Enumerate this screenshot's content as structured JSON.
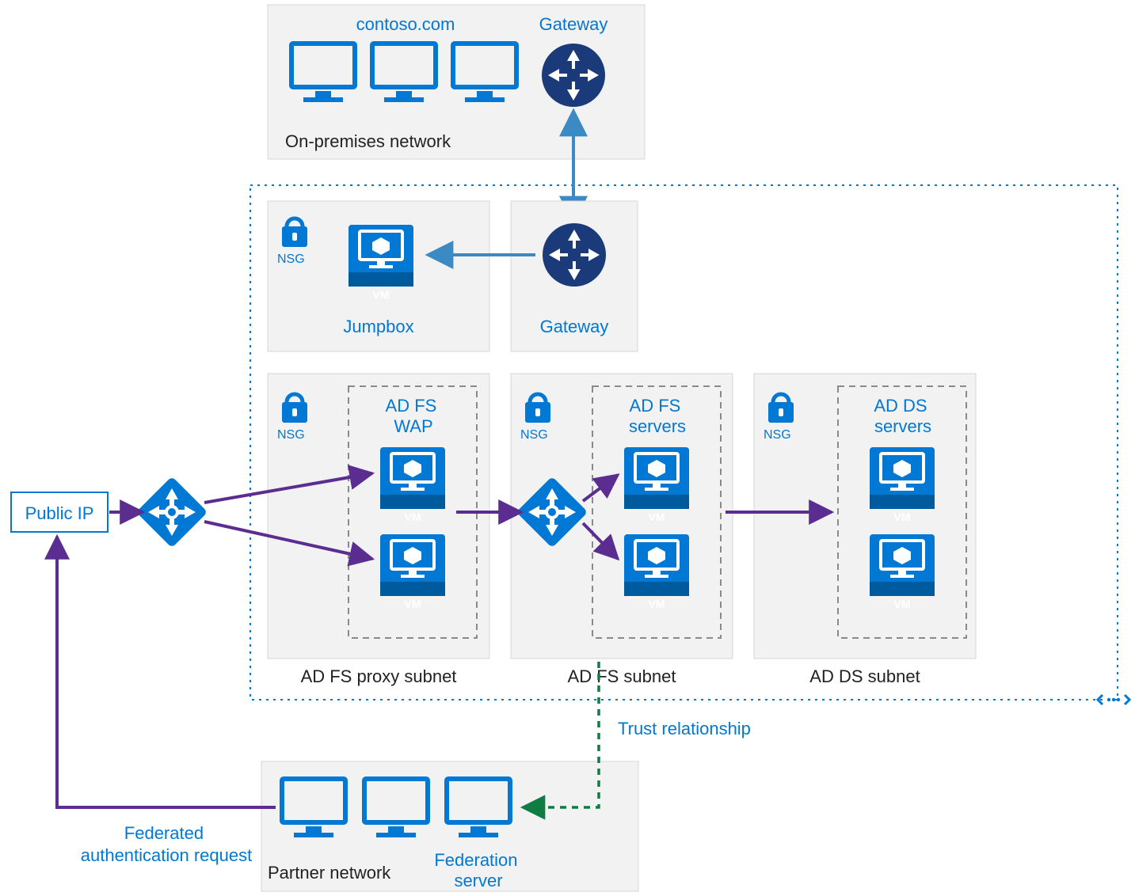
{
  "onprem": {
    "domain": "contoso.com",
    "gateway": "Gateway",
    "label": "On-premises network"
  },
  "vnet": {
    "jumpbox": {
      "nsg": "NSG",
      "label": "Jumpbox"
    },
    "gateway": {
      "label": "Gateway"
    },
    "adfs_proxy": {
      "nsg": "NSG",
      "title": "AD FS WAP",
      "label": "AD FS proxy subnet"
    },
    "adfs": {
      "nsg": "NSG",
      "title": "AD FS servers",
      "label": "AD FS subnet"
    },
    "adds": {
      "nsg": "NSG",
      "title": "AD DS servers",
      "label": "AD DS subnet"
    },
    "vm_label": "VM"
  },
  "public_ip": "Public IP",
  "partner": {
    "label": "Partner network",
    "federation": "Federation server"
  },
  "trust": "Trust relationship",
  "federated_request_line1": "Federated",
  "federated_request_line2": "authentication request"
}
